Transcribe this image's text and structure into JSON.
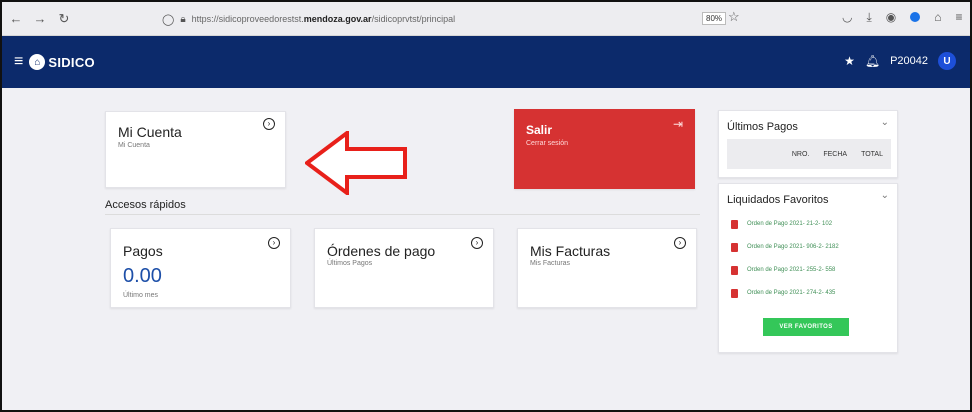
{
  "browser": {
    "url_prefix": "https://sidicoproveedorestst.",
    "url_domain": "mendoza.gov.ar",
    "url_path": "/sidicoprvtst/principal",
    "zoom": "80%"
  },
  "header": {
    "app_name": "SIDICO",
    "user": "P20042",
    "avatar_letter": "U"
  },
  "cards": {
    "mi_cuenta": {
      "title": "Mi Cuenta",
      "subtitle": "Mi Cuenta"
    },
    "salir": {
      "title": "Salir",
      "subtitle": "Cerrar sesión"
    },
    "accesos_label": "Accesos rápidos",
    "pagos": {
      "title": "Pagos",
      "amount": "0.00",
      "subtitle": "Último mes"
    },
    "ordenes": {
      "title": "Órdenes de pago",
      "subtitle": "Últimos Pagos"
    },
    "facturas": {
      "title": "Mis Facturas",
      "subtitle": "Mis Facturas"
    }
  },
  "ultimos_pagos": {
    "title": "Últimos Pagos",
    "columns": [
      "NRO.",
      "FECHA",
      "TOTAL"
    ]
  },
  "liquidados": {
    "title": "Liquidados Favoritos",
    "items": [
      "Orden de Pago 2021- 21-2- 102",
      "Orden de Pago 2021- 906-2- 2182",
      "Orden de Pago 2021- 255-2- 558",
      "Orden de Pago 2021- 274-2- 435"
    ],
    "button": "VER FAVORITOS"
  },
  "colors": {
    "header_bg": "#0c2a6b",
    "salir_bg": "#d63232",
    "amount": "#1d4fa8",
    "fav_link": "#3f8f56",
    "button_green": "#34c759",
    "annotation_arrow": "#e8201a"
  }
}
